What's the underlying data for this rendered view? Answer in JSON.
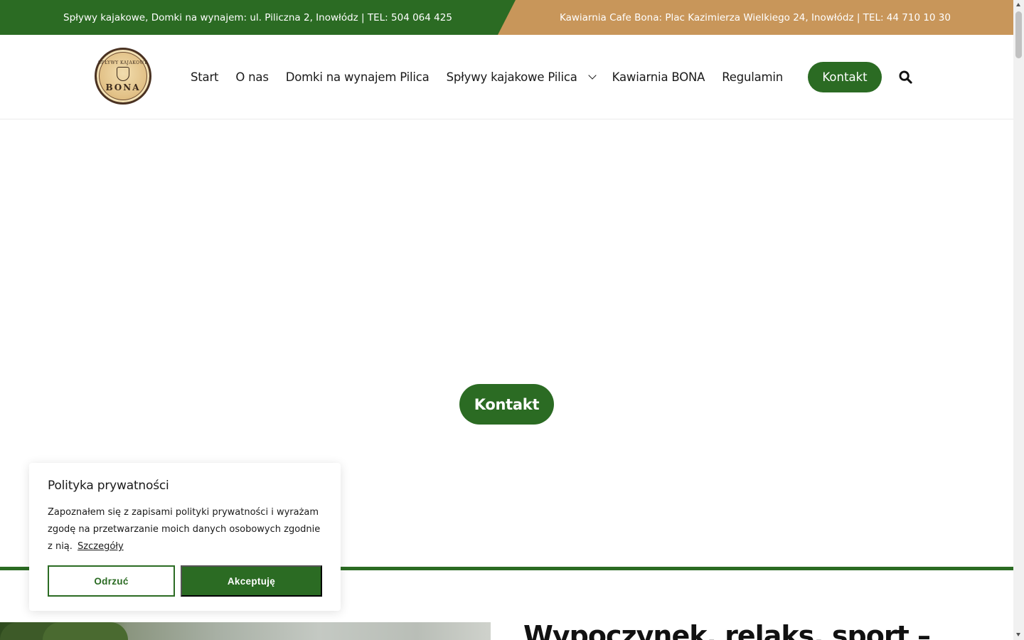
{
  "topbar": {
    "left_text": "Spływy kajakowe, Domki na wynajem: ul. Piliczna 2, Inowłódz | TEL: 504 064 425",
    "right_text": "Kawiarnia Cafe Bona: Plac Kazimierza Wielkiego 24, Inowłódz | TEL: 44 710 10 30"
  },
  "logo": {
    "top_text": "SPŁYWY KAJAKOWE",
    "bottom_text": "BONA"
  },
  "nav": {
    "items": [
      {
        "label": "Start"
      },
      {
        "label": "O nas"
      },
      {
        "label": "Domki na wynajem Pilica"
      },
      {
        "label": "Spływy kajakowe Pilica"
      },
      {
        "label": "Kawiarnia BONA"
      },
      {
        "label": "Regulamin"
      }
    ],
    "contact_label": "Kontakt"
  },
  "hero": {
    "contact_label": "Kontakt"
  },
  "section": {
    "heading": "Wypoczynek, relaks, sport –"
  },
  "cookie": {
    "title": "Polityka prywatności",
    "text": "Zapoznałem się z zapisami polityki prywatności i wyrażam zgodę na przetwarzanie moich danych osobowych zgodnie z nią.",
    "details_link": "Szczegóły",
    "reject_label": "Odrzuć",
    "accept_label": "Akceptuję"
  },
  "colors": {
    "brand_green": "#2b6b23",
    "brand_tan": "#c8965a"
  }
}
